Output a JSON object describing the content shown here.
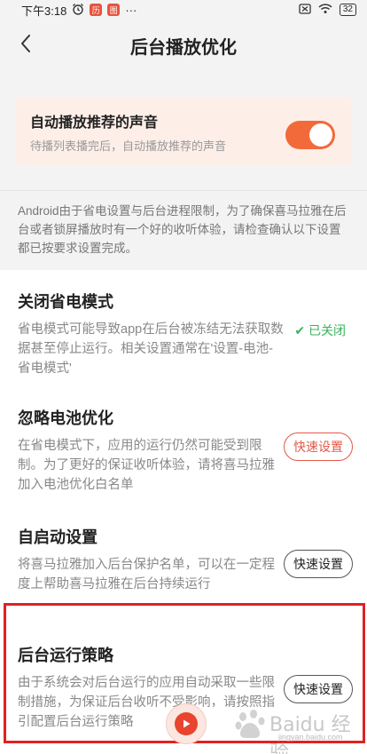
{
  "status_bar": {
    "time": "下午3:18",
    "app_icon_1": "历",
    "app_icon_2": "图",
    "more": "···",
    "battery": "32"
  },
  "header": {
    "title": "后台播放优化"
  },
  "autoplay": {
    "title": "自动播放推荐的声音",
    "subtitle": "待播列表播完后，自动播放推荐的声音",
    "enabled": true
  },
  "notice": "Android由于省电设置与后台进程限制，为了确保喜马拉雅在后台或者锁屏播放时有一个好的收听体验，请检查确认以下设置都已按要求设置完成。",
  "sections": [
    {
      "title": "关闭省电模式",
      "desc": "省电模式可能导致app在后台被冻结无法获取数据甚至停止运行。相关设置通常在'设置-电池-省电模式'",
      "status": "✔ 已关闭"
    },
    {
      "title": "忽略电池优化",
      "desc": "在省电模式下，应用的运行仍然可能受到限制。为了更好的保证收听体验，请将喜马拉雅加入电池优化白名单",
      "button": "快速设置"
    },
    {
      "title": "自启动设置",
      "desc": "将喜马拉雅加入后台保护名单，可以在一定程度上帮助喜马拉雅在后台持续运行",
      "button": "快速设置"
    },
    {
      "title": "后台运行策略",
      "desc": "由于系统会对后台运行的应用自动采取一些限制措施，为保证后台收听不受影响，请按照指引配置后台运行策略",
      "button": "快速设置"
    }
  ],
  "watermark": {
    "text": "Baidu 经验",
    "url": "jingyan.baidu.com"
  },
  "colors": {
    "accent": "#f26a3a",
    "success": "#38b35a",
    "highlight": "#e02222"
  },
  "icons": [
    "alarm-icon",
    "sim-icon",
    "wifi-icon",
    "battery-icon",
    "back-arrow-icon",
    "check-icon",
    "play-icon"
  ]
}
